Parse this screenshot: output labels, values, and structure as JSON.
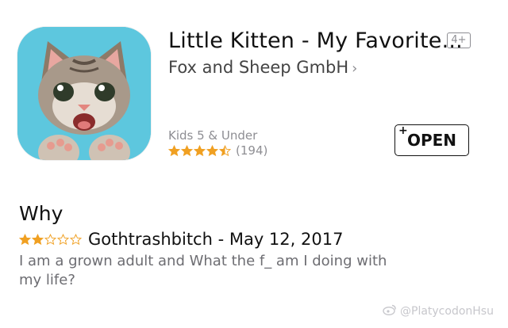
{
  "app": {
    "title": "Little Kitten - My Favorite...",
    "age_rating": "4+",
    "developer": "Fox and Sheep GmbH",
    "category": "Kids 5 & Under",
    "rating_stars": 4.5,
    "rating_count": "(194)",
    "open_label": "OPEN",
    "open_plus": "+"
  },
  "review": {
    "title": "Why",
    "stars": 2,
    "author_date": "Gothtrashbitch - May 12, 2017",
    "body": "I am a grown adult and What the f_ am I doing with my life?"
  },
  "watermark": {
    "text": "@PlatycodonHsu"
  },
  "colors": {
    "star_app": "#f0a022",
    "star_review": "#f0a022",
    "icon_bg": "#5dc7de"
  }
}
